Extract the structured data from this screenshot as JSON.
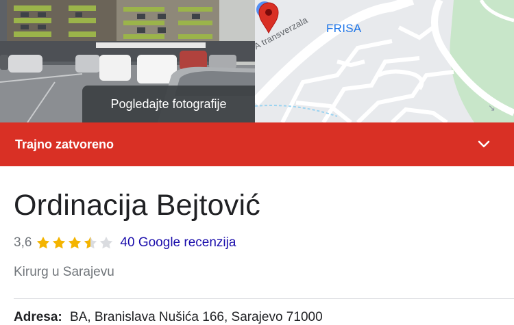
{
  "photo": {
    "button_label": "Pogledajte fotografije"
  },
  "map": {
    "road_label": "A transverzala",
    "place_label": "FRISA",
    "pin_color": "#d93025",
    "label_color": "#1a73e8"
  },
  "status": {
    "label": "Trajno zatvoreno",
    "color": "#d93025",
    "icon": "chevron-down-icon"
  },
  "business": {
    "name": "Ordinacija Bejtović",
    "rating": "3,6",
    "rating_numeric": 3.6,
    "stars_max": 5,
    "reviews_label": "40 Google recenzija",
    "category": "Kirurg u Sarajevu",
    "address_label": "Adresa:",
    "address_value": "BA, Branislava Nušića 166, Sarajevo 71000"
  },
  "colors": {
    "star_fill": "#f4b400",
    "star_empty": "#dadce0",
    "link": "#1a0dab"
  }
}
